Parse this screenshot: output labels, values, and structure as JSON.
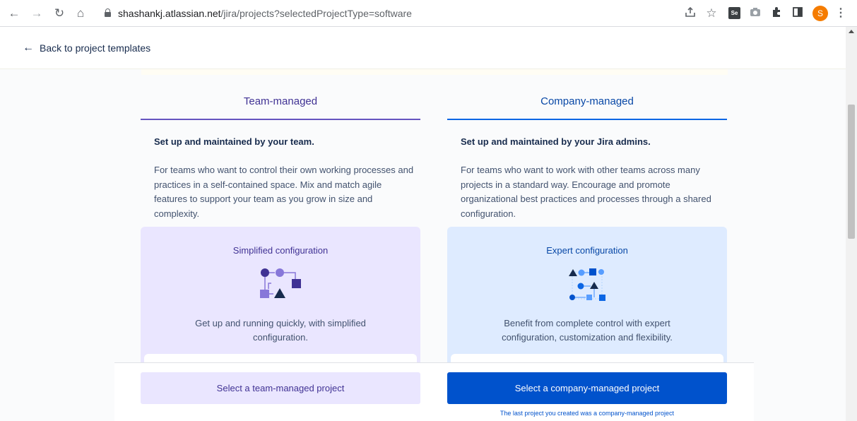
{
  "browser": {
    "url_host": "shashankj.atlassian.net",
    "url_path": "/jira/projects?selectedProjectType=software",
    "profile_initial": "S",
    "extension_label": "Se",
    "icons": [
      "back-arrow-icon",
      "forward-arrow-icon",
      "reload-icon",
      "home-icon",
      "lock-icon",
      "share-icon",
      "star-icon",
      "camera-icon",
      "puzzle-icon",
      "sidebar-icon",
      "kebab-menu-icon"
    ]
  },
  "page": {
    "back_link": "Back to project templates"
  },
  "team": {
    "tab_label": "Team-managed",
    "heading": "Set up and maintained by your team.",
    "description": "For teams who want to control their own working processes and practices in a self-contained space. Mix and match agile features to support your team as you grow in size and complexity.",
    "card_title": "Simplified configuration",
    "card_description": "Get up and running quickly, with simplified configuration.",
    "button_label": "Select a team-managed project",
    "accent_color": "#6554c0"
  },
  "company": {
    "tab_label": "Company-managed",
    "heading": "Set up and maintained by your Jira admins.",
    "description": "For teams who want to work with other teams across many projects in a standard way. Encourage and promote organizational best practices and processes through a shared configuration.",
    "card_title": "Expert configuration",
    "card_description": "Benefit from complete control with expert configuration, customization and flexibility.",
    "button_label": "Select a company-managed project",
    "last_project_note": "The last project you created was a company-managed project",
    "accent_color": "#0052cc"
  }
}
